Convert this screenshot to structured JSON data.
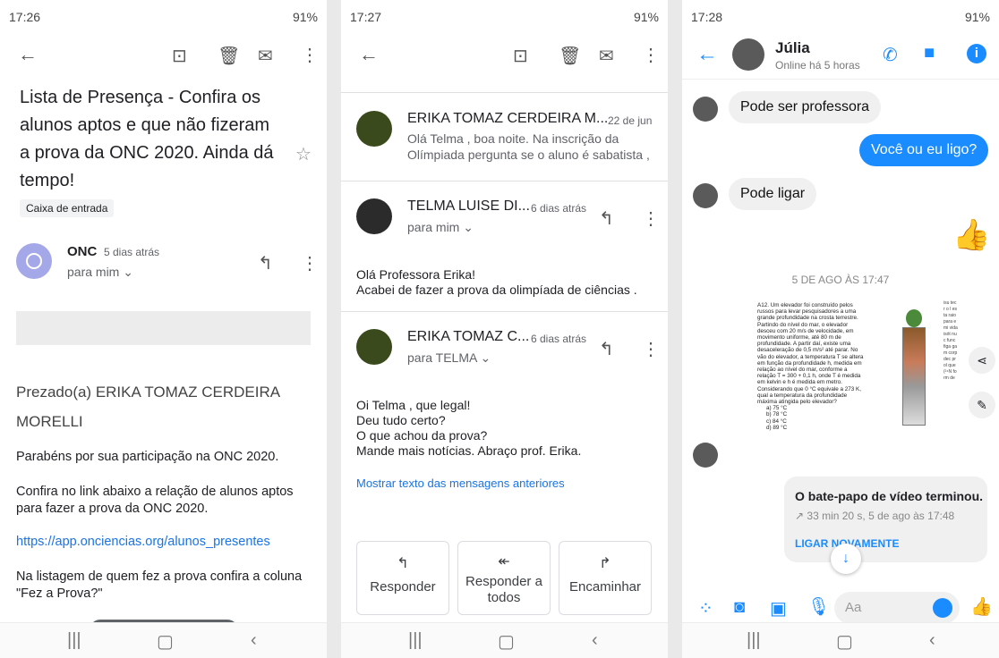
{
  "p1": {
    "status_time": "17:26",
    "status_right": "91%",
    "subject": "Lista de Presença - Confira os alunos  aptos e que não fizeram a prova da ONC 2020. Ainda dá tempo!",
    "label": "Caixa de entrada",
    "sender": "ONC",
    "time": "5 dias atrás",
    "to": "para mim",
    "greeting": "Prezado(a) ERIKA TOMAZ CERDEIRA MORELLI",
    "p1": "Parabéns por sua participação na ONC 2020.",
    "p2": "Confira no link abaixo a relação de alunos aptos para fazer a prova da ONC 2020.",
    "link": "https://app.onciencias.org/alunos_presentes",
    "p3": "Na listagem de quem fez a prova confira a coluna \"Fez a Prova?\""
  },
  "p2": {
    "status_time": "17:27",
    "status_right": "91%",
    "m1_sender": "ERIKA TOMAZ CERDEIRA M...",
    "m1_date": "22 de jun",
    "m1_snip": "Olá Telma , boa noite. Na inscrição da Olímpiada pergunta se o aluno é sabatista ,",
    "m2_sender": "TELMA LUISE DI...",
    "m2_date": "6 dias atrás",
    "m2_to": "para mim",
    "m2_body1": "Olá Professora Erika!",
    "m2_body2": "Acabei de fazer a prova da olimpíada de ciências .",
    "m3_sender": "ERIKA TOMAZ C...",
    "m3_date": "6 dias atrás",
    "m3_to": "para TELMA",
    "m3_l1": "Oi Telma , que legal!",
    "m3_l2": "Deu tudo certo?",
    "m3_l3": "O que achou da prova?",
    "m3_l4": "Mande mais notícias. Abraço prof. Erika.",
    "show_prev": "Mostrar texto das mensagens anteriores",
    "reply": "Responder",
    "reply_all": "Responder a todos",
    "forward": "Encaminhar"
  },
  "p3": {
    "status_time": "17:28",
    "status_right": "91%",
    "name": "Júlia",
    "online": "Online há 5 horas",
    "msg1": "Pode ser professora",
    "msg2": "Você ou eu ligo?",
    "msg3": "Pode ligar",
    "date_sep": "5 DE AGO ÀS 17:47",
    "doc_lines": [
      "A12. Um elevador foi construído pelos",
      "russos para levar pesquisadores a uma",
      "grande profundidade na crosta terrestre.",
      "Partindo do nível do mar, o elevador",
      "desceu com 20 m/s de velocidade, em",
      "movimento uniforme, até 80 m de",
      "profundidade. A partir daí, existe uma",
      "desaceleração de 0,5 m/s² até parar. No",
      "vão do elevador, a temperatura T se altera",
      "em função da profundidade h, medida em",
      "relação ao nível do mar, conforme a",
      "relação T = 300 + 0,1 h, onde T é medida",
      "em kelvin e h é medida em metro.",
      "Considerando que 0 °C equivale a 273 K,",
      "qual a temperatura da profundidade",
      "máxima atingida pelo elevador?",
      "a) 75 °C",
      "b) 78 °C",
      "c) 84 °C",
      "d) 89 °C"
    ],
    "call_title": "O bate-papo de vídeo terminou.",
    "call_info": "33 min 20 s, 5 de ago às 17:48",
    "call_again": "LIGAR NOVAMENTE",
    "input_ph": "Aa"
  }
}
